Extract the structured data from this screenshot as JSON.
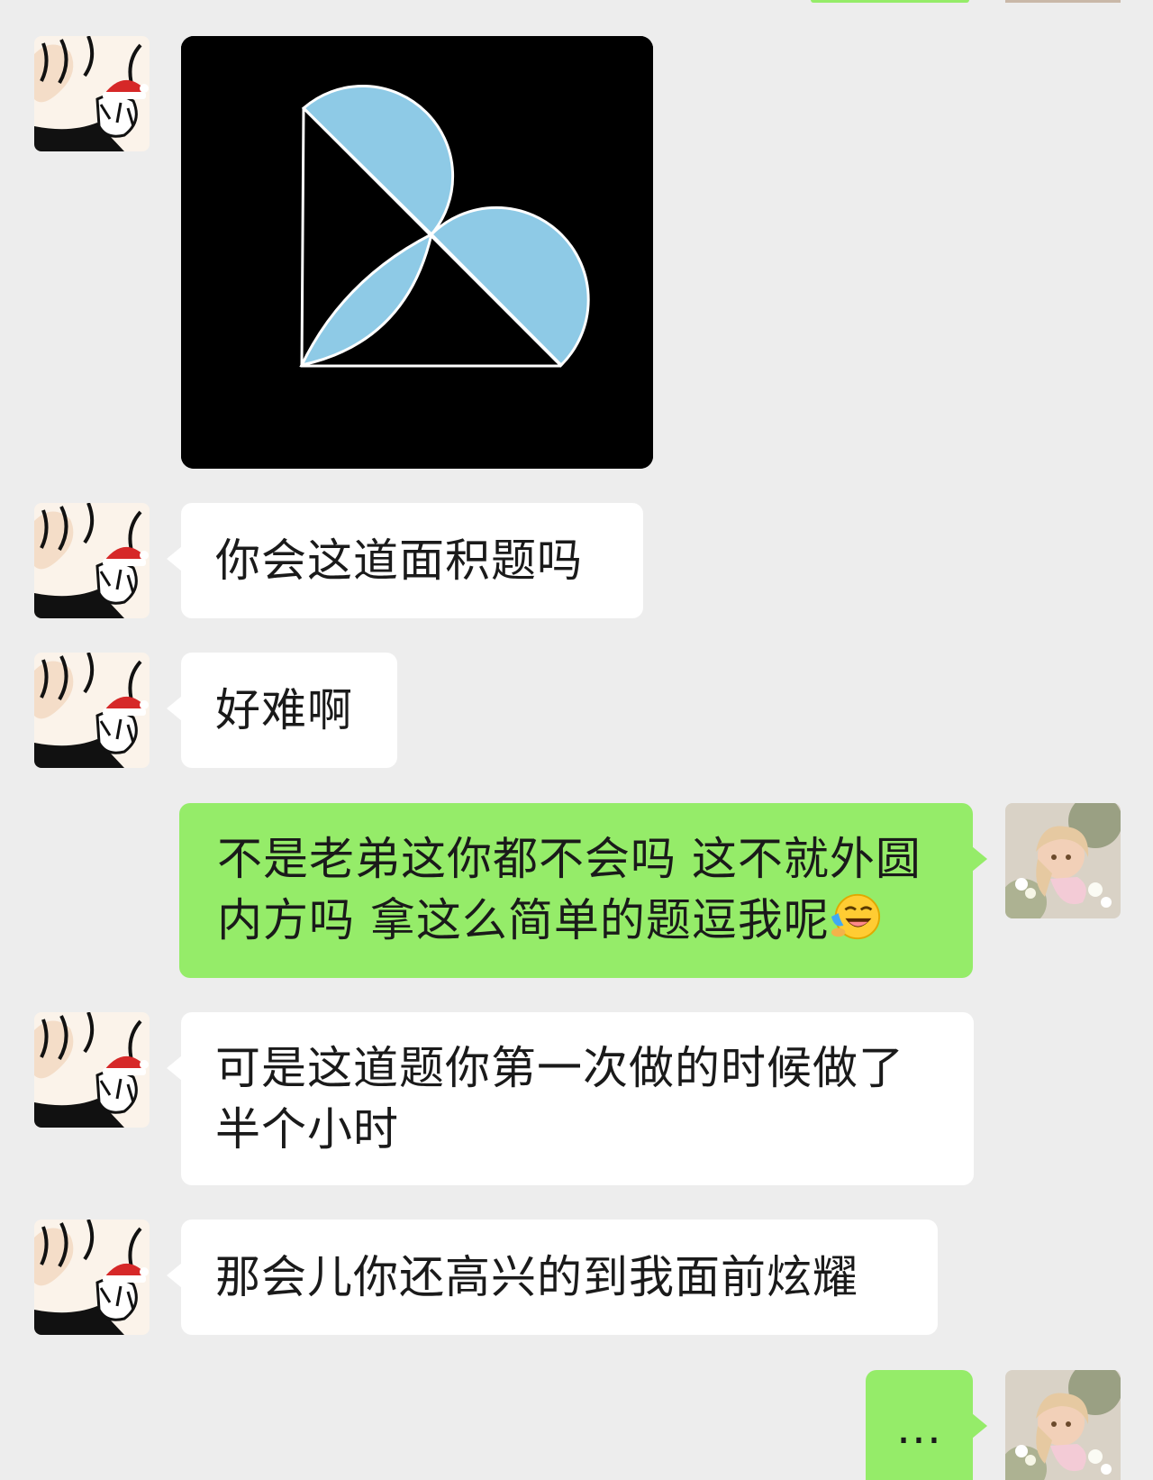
{
  "colors": {
    "background": "#ededed",
    "incoming_bubble": "#ffffff",
    "outgoing_bubble": "#95ec69",
    "text": "#1a1a1a",
    "figure_fill": "#8ecae6",
    "figure_stroke": "#ffffff",
    "image_background": "#000000"
  },
  "messages": [
    {
      "sender": "friend",
      "type": "image",
      "image_alt": ""
    },
    {
      "sender": "friend",
      "type": "text",
      "text": "你会这道面积题吗"
    },
    {
      "sender": "friend",
      "type": "text",
      "text": "好难啊"
    },
    {
      "sender": "me",
      "type": "text",
      "lines": [
        "不是老弟这你都不会吗 这不就外圆",
        "内方吗 拿这么简单的题逗我呢"
      ],
      "emoji": "face-with-tears-of-joy"
    },
    {
      "sender": "friend",
      "type": "text",
      "lines": [
        "可是这道题你第一次做的时候做了",
        "半个小时"
      ]
    },
    {
      "sender": "friend",
      "type": "text",
      "text": "那会儿你还高兴的到我面前炫耀"
    },
    {
      "sender": "me",
      "type": "text",
      "text": "..."
    }
  ],
  "avatars": {
    "friend": "anime-boy-santa-hat-avatar",
    "me": "anime-girl-flowers-avatar"
  }
}
